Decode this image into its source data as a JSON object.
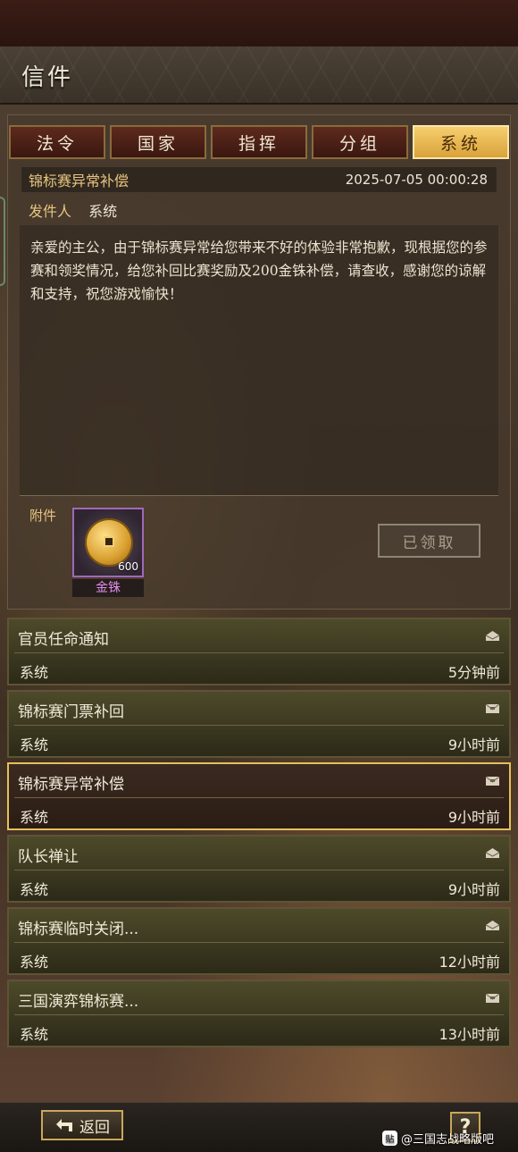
{
  "header": {
    "title": "信件"
  },
  "tabs": [
    {
      "label": "法令",
      "active": false
    },
    {
      "label": "国家",
      "active": false
    },
    {
      "label": "指挥",
      "active": false
    },
    {
      "label": "分组",
      "active": false
    },
    {
      "label": "系统",
      "active": true
    }
  ],
  "mail": {
    "subject": "锦标赛异常补偿",
    "datetime": "2025-07-05 00:00:28",
    "sender_label": "发件人",
    "sender": "系统",
    "body": "亲爱的主公，由于锦标赛异常给您带来不好的体验非常抱歉，现根据您的参赛和领奖情况，给您补回比赛奖励及200金铢补偿，请查收，感谢您的谅解和支持，祝您游戏愉快！",
    "attachment_label": "附件",
    "attachment": {
      "name": "金铢",
      "count": "600",
      "icon": "gold-coin-icon"
    },
    "claim_button": "已领取"
  },
  "mail_list": [
    {
      "title": "官员任命通知",
      "sender": "系统",
      "time": "5分钟前",
      "icon": "envelope-open-icon",
      "selected": false
    },
    {
      "title": "锦标赛门票补回",
      "sender": "系统",
      "time": "9小时前",
      "icon": "envelope-attachment-icon",
      "selected": false
    },
    {
      "title": "锦标赛异常补偿",
      "sender": "系统",
      "time": "9小时前",
      "icon": "envelope-attachment-icon",
      "selected": true
    },
    {
      "title": "队长禅让",
      "sender": "系统",
      "time": "9小时前",
      "icon": "envelope-open-icon",
      "selected": false
    },
    {
      "title": "锦标赛临时关闭...",
      "sender": "系统",
      "time": "12小时前",
      "icon": "envelope-open-icon",
      "selected": false
    },
    {
      "title": "三国演弈锦标赛...",
      "sender": "系统",
      "time": "13小时前",
      "icon": "envelope-attachment-icon",
      "selected": false
    }
  ],
  "footer": {
    "back_label": "返回",
    "help_label": "?",
    "watermark_logo": "贴",
    "watermark": "@三国志战略版吧"
  },
  "colors": {
    "accent_gold": "#e6c05a",
    "active_tab": "#f6cf6e",
    "attachment_border": "#a068b8",
    "attachment_name": "#e08ce8"
  }
}
